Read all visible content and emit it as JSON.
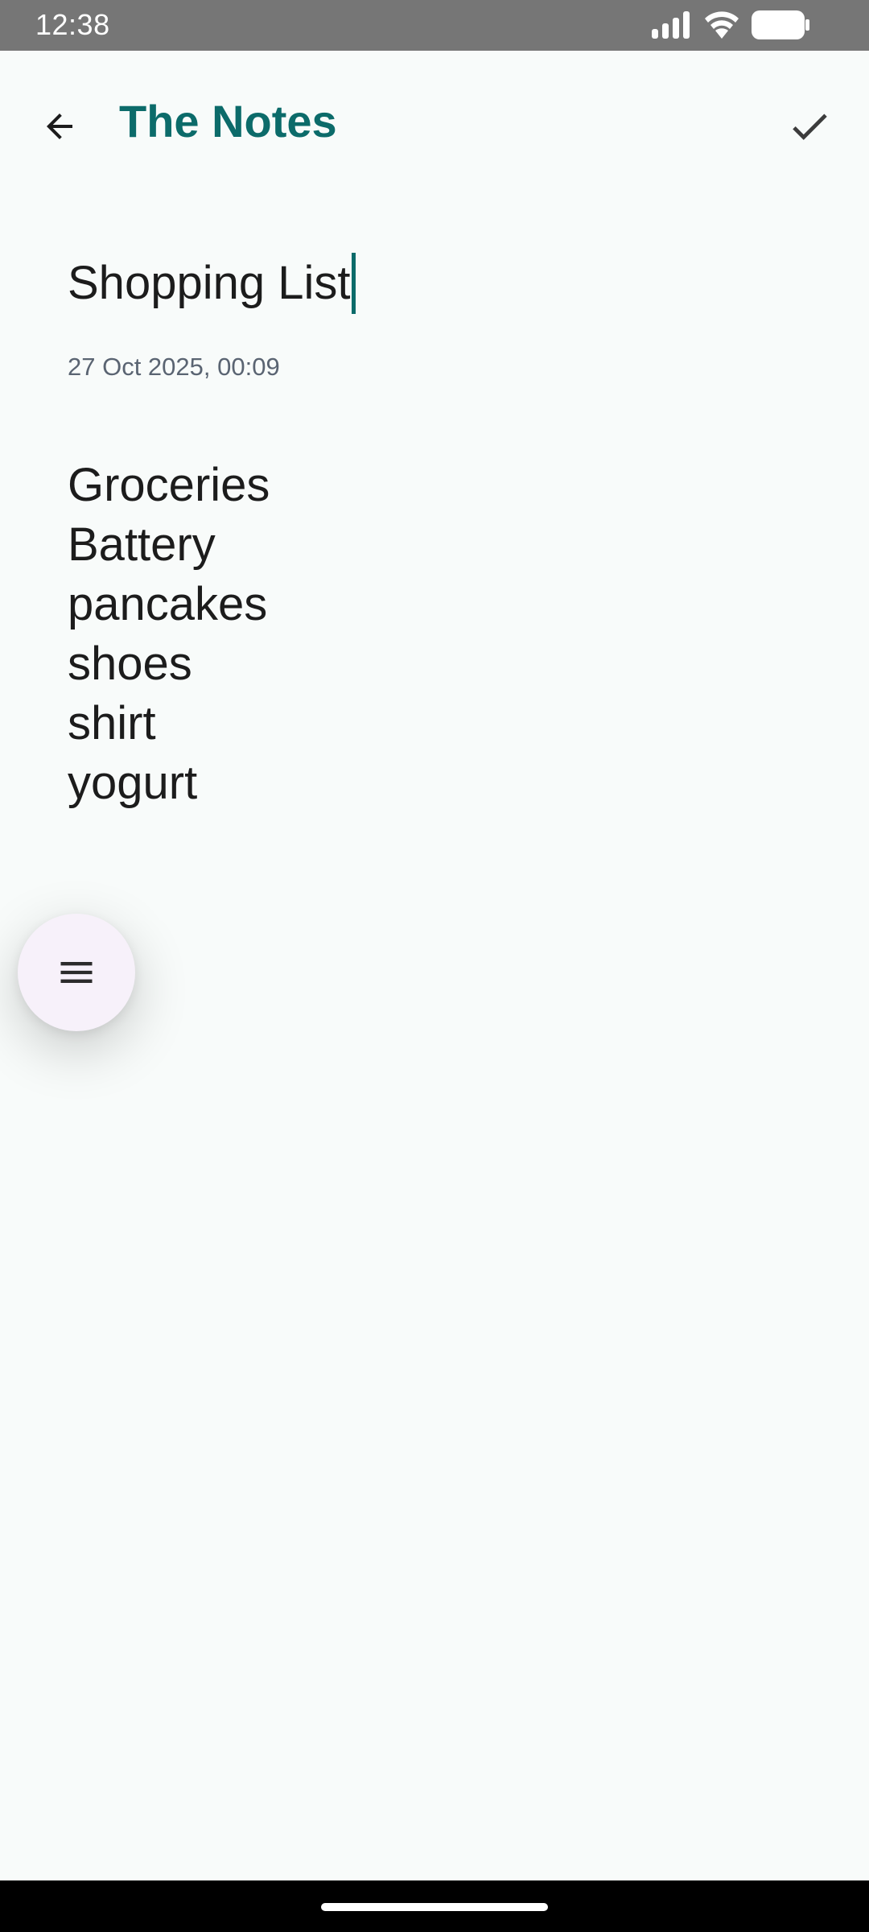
{
  "status_bar": {
    "time": "12:38",
    "icons": [
      "signal-icon",
      "wifi-icon",
      "battery-icon"
    ]
  },
  "app_bar": {
    "title": "The Notes",
    "back_icon": "arrow-back-icon",
    "done_icon": "check-icon"
  },
  "note": {
    "title": "Shopping List",
    "timestamp": "27 Oct 2025, 00:09",
    "lines": [
      "Groceries",
      "Battery",
      "pancakes",
      "shoes",
      "shirt",
      "yogurt"
    ]
  },
  "fab": {
    "icon": "menu-icon"
  },
  "colors": {
    "accent": "#0c6b6a",
    "background": "#f8fbfa",
    "status_bar": "#767676",
    "fab_background": "#f7f1fa",
    "timestamp": "#5a6472"
  }
}
